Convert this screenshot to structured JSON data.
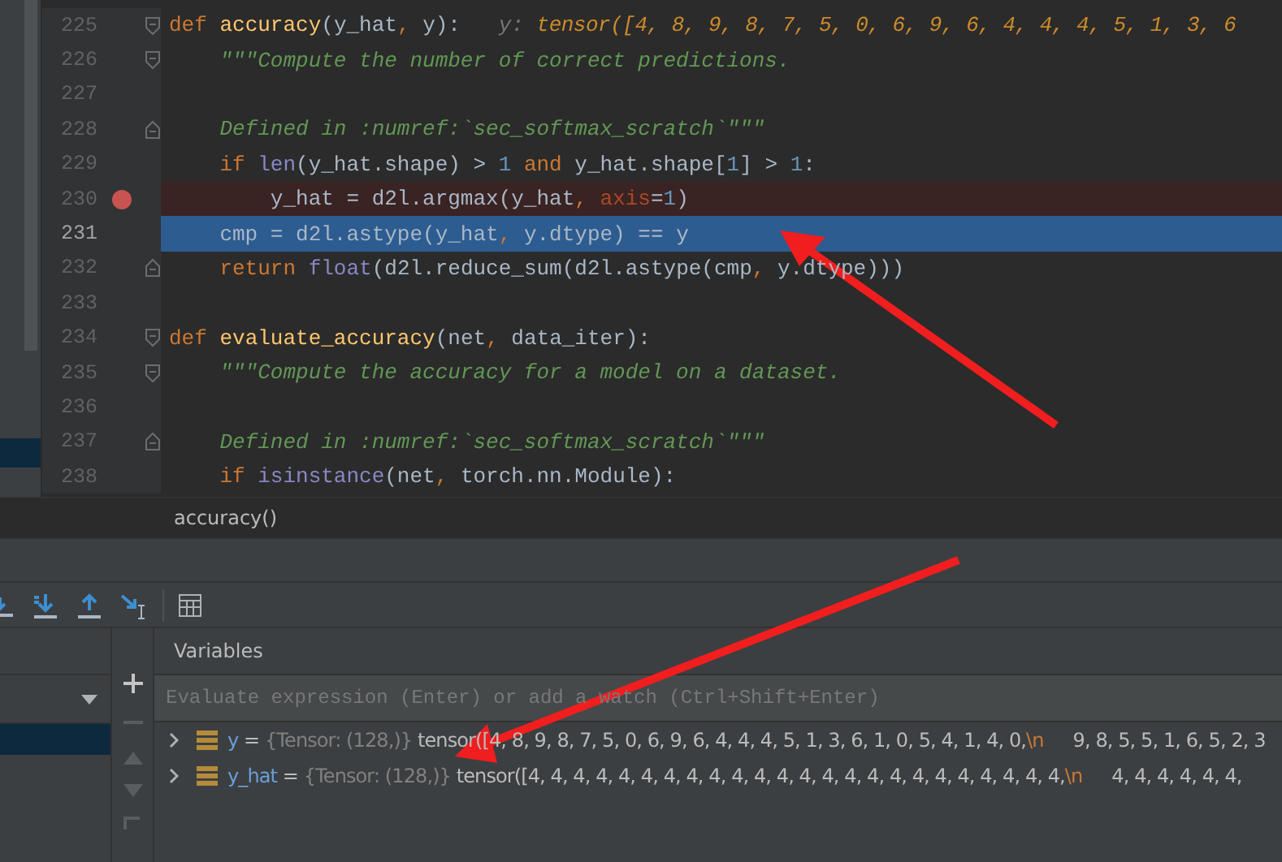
{
  "editor": {
    "lines": [
      {
        "number": "225",
        "kind": "fold-start",
        "breakpoint": false,
        "current": false,
        "tokens": [
          {
            "kind": "kw",
            "text": "def "
          },
          {
            "kind": "fn",
            "text": "accuracy"
          },
          {
            "kind": "plain",
            "text": "(y_hat"
          },
          {
            "kind": "kw",
            "text": ", "
          },
          {
            "kind": "plain",
            "text": "y):   "
          },
          {
            "kind": "hint-name",
            "text": "y: "
          },
          {
            "kind": "hint-value",
            "text": "tensor([4, 8, 9, 8, 7, 5, 0, 6, 9, 6, 4, 4, 4, 5, 1, 3, 6"
          }
        ]
      },
      {
        "number": "226",
        "kind": "fold-start",
        "breakpoint": false,
        "current": false,
        "tokens": [
          {
            "kind": "doc",
            "text": "    \"\"\"Compute the number of correct predictions."
          }
        ]
      },
      {
        "number": "227",
        "kind": "plain",
        "breakpoint": false,
        "current": false
      },
      {
        "number": "228",
        "kind": "fold-end",
        "breakpoint": false,
        "current": false,
        "tokens": [
          {
            "kind": "doc",
            "text": "    Defined in :numref:`sec_softmax_scratch`\"\"\""
          }
        ]
      },
      {
        "number": "229",
        "kind": "plain",
        "breakpoint": false,
        "current": false,
        "tokens": [
          {
            "kind": "kw",
            "text": "    if "
          },
          {
            "kind": "builtin",
            "text": "len"
          },
          {
            "kind": "plain",
            "text": "(y_hat.shape) > "
          },
          {
            "kind": "num",
            "text": "1 "
          },
          {
            "kind": "kw",
            "text": "and "
          },
          {
            "kind": "plain",
            "text": "y_hat.shape["
          },
          {
            "kind": "num",
            "text": "1"
          },
          {
            "kind": "plain",
            "text": "] > "
          },
          {
            "kind": "num",
            "text": "1"
          },
          {
            "kind": "plain",
            "text": ":"
          }
        ]
      },
      {
        "number": "230",
        "kind": "plain",
        "breakpoint": true,
        "current": false,
        "tokens": [
          {
            "kind": "plain",
            "text": "        y_hat = d2l.argmax(y_hat"
          },
          {
            "kind": "kw",
            "text": ", "
          },
          {
            "kind": "param",
            "text": "axis"
          },
          {
            "kind": "plain",
            "text": "="
          },
          {
            "kind": "num",
            "text": "1"
          },
          {
            "kind": "plain",
            "text": ")"
          }
        ]
      },
      {
        "number": "231",
        "kind": "plain",
        "breakpoint": false,
        "current": true,
        "tokens": [
          {
            "kind": "plain",
            "text": "    cmp = d2l.astype(y_hat"
          },
          {
            "kind": "kw",
            "text": ", "
          },
          {
            "kind": "plain",
            "text": "y.dtype) == y"
          }
        ]
      },
      {
        "number": "232",
        "kind": "fold-end",
        "breakpoint": false,
        "current": false,
        "tokens": [
          {
            "kind": "kw",
            "text": "    return "
          },
          {
            "kind": "builtin",
            "text": "float"
          },
          {
            "kind": "plain",
            "text": "(d2l.reduce_sum(d2l.astype(cmp"
          },
          {
            "kind": "kw",
            "text": ", "
          },
          {
            "kind": "plain",
            "text": "y.dtype)))"
          }
        ]
      },
      {
        "number": "233",
        "kind": "plain",
        "breakpoint": false,
        "current": false
      },
      {
        "number": "234",
        "kind": "fold-start",
        "breakpoint": false,
        "current": false,
        "tokens": [
          {
            "kind": "kw",
            "text": "def "
          },
          {
            "kind": "fn",
            "text": "evaluate_accuracy"
          },
          {
            "kind": "plain",
            "text": "(net"
          },
          {
            "kind": "kw",
            "text": ", "
          },
          {
            "kind": "plain",
            "text": "data_iter):"
          }
        ]
      },
      {
        "number": "235",
        "kind": "fold-start",
        "breakpoint": false,
        "current": false,
        "tokens": [
          {
            "kind": "doc",
            "text": "    \"\"\"Compute the accuracy for a model on a dataset."
          }
        ]
      },
      {
        "number": "236",
        "kind": "plain",
        "breakpoint": false,
        "current": false
      },
      {
        "number": "237",
        "kind": "fold-end",
        "breakpoint": false,
        "current": false,
        "tokens": [
          {
            "kind": "doc",
            "text": "    Defined in :numref:`sec_softmax_scratch`\"\"\""
          }
        ]
      },
      {
        "number": "238",
        "kind": "plain",
        "breakpoint": false,
        "current": false,
        "tokens": [
          {
            "kind": "kw",
            "text": "    if "
          },
          {
            "kind": "builtin",
            "text": "isinstance"
          },
          {
            "kind": "plain",
            "text": "(net"
          },
          {
            "kind": "kw",
            "text": ", "
          },
          {
            "kind": "plain",
            "text": "torch.nn.Module):"
          }
        ]
      }
    ]
  },
  "breadcrumb": "accuracy()",
  "frames": {
    "items": [
      {
        "selected": true
      }
    ]
  },
  "variables": {
    "title": "Variables",
    "watch": {
      "placeholder": "Evaluate expression (Enter) or add a watch (Ctrl+Shift+Enter)"
    },
    "rows": [
      {
        "name": "y",
        "operator": "=",
        "type": "{Tensor: (128,)}",
        "value": "tensor([4, 8, 9, 8, 7, 5, 0, 6, 9, 6, 4, 4, 4, 5, 1, 3, 6, 1, 0, 5, 4, 1, 4, 0,",
        "escape": "\\n",
        "continuation": "9, 8, 5, 5, 1, 6, 5, 2, 3",
        "expanded": false
      },
      {
        "name": "y_hat",
        "operator": "=",
        "type": "{Tensor: (128,)}",
        "value": "tensor([4, 4, 4, 4, 4, 4, 4, 4, 4, 4, 4, 4, 4, 4, 4, 4, 4, 4, 4, 4, 4, 4, 4, 4,",
        "escape": "\\n",
        "continuation": "4, 4, 4, 4, 4, 4,",
        "expanded": false
      }
    ]
  }
}
